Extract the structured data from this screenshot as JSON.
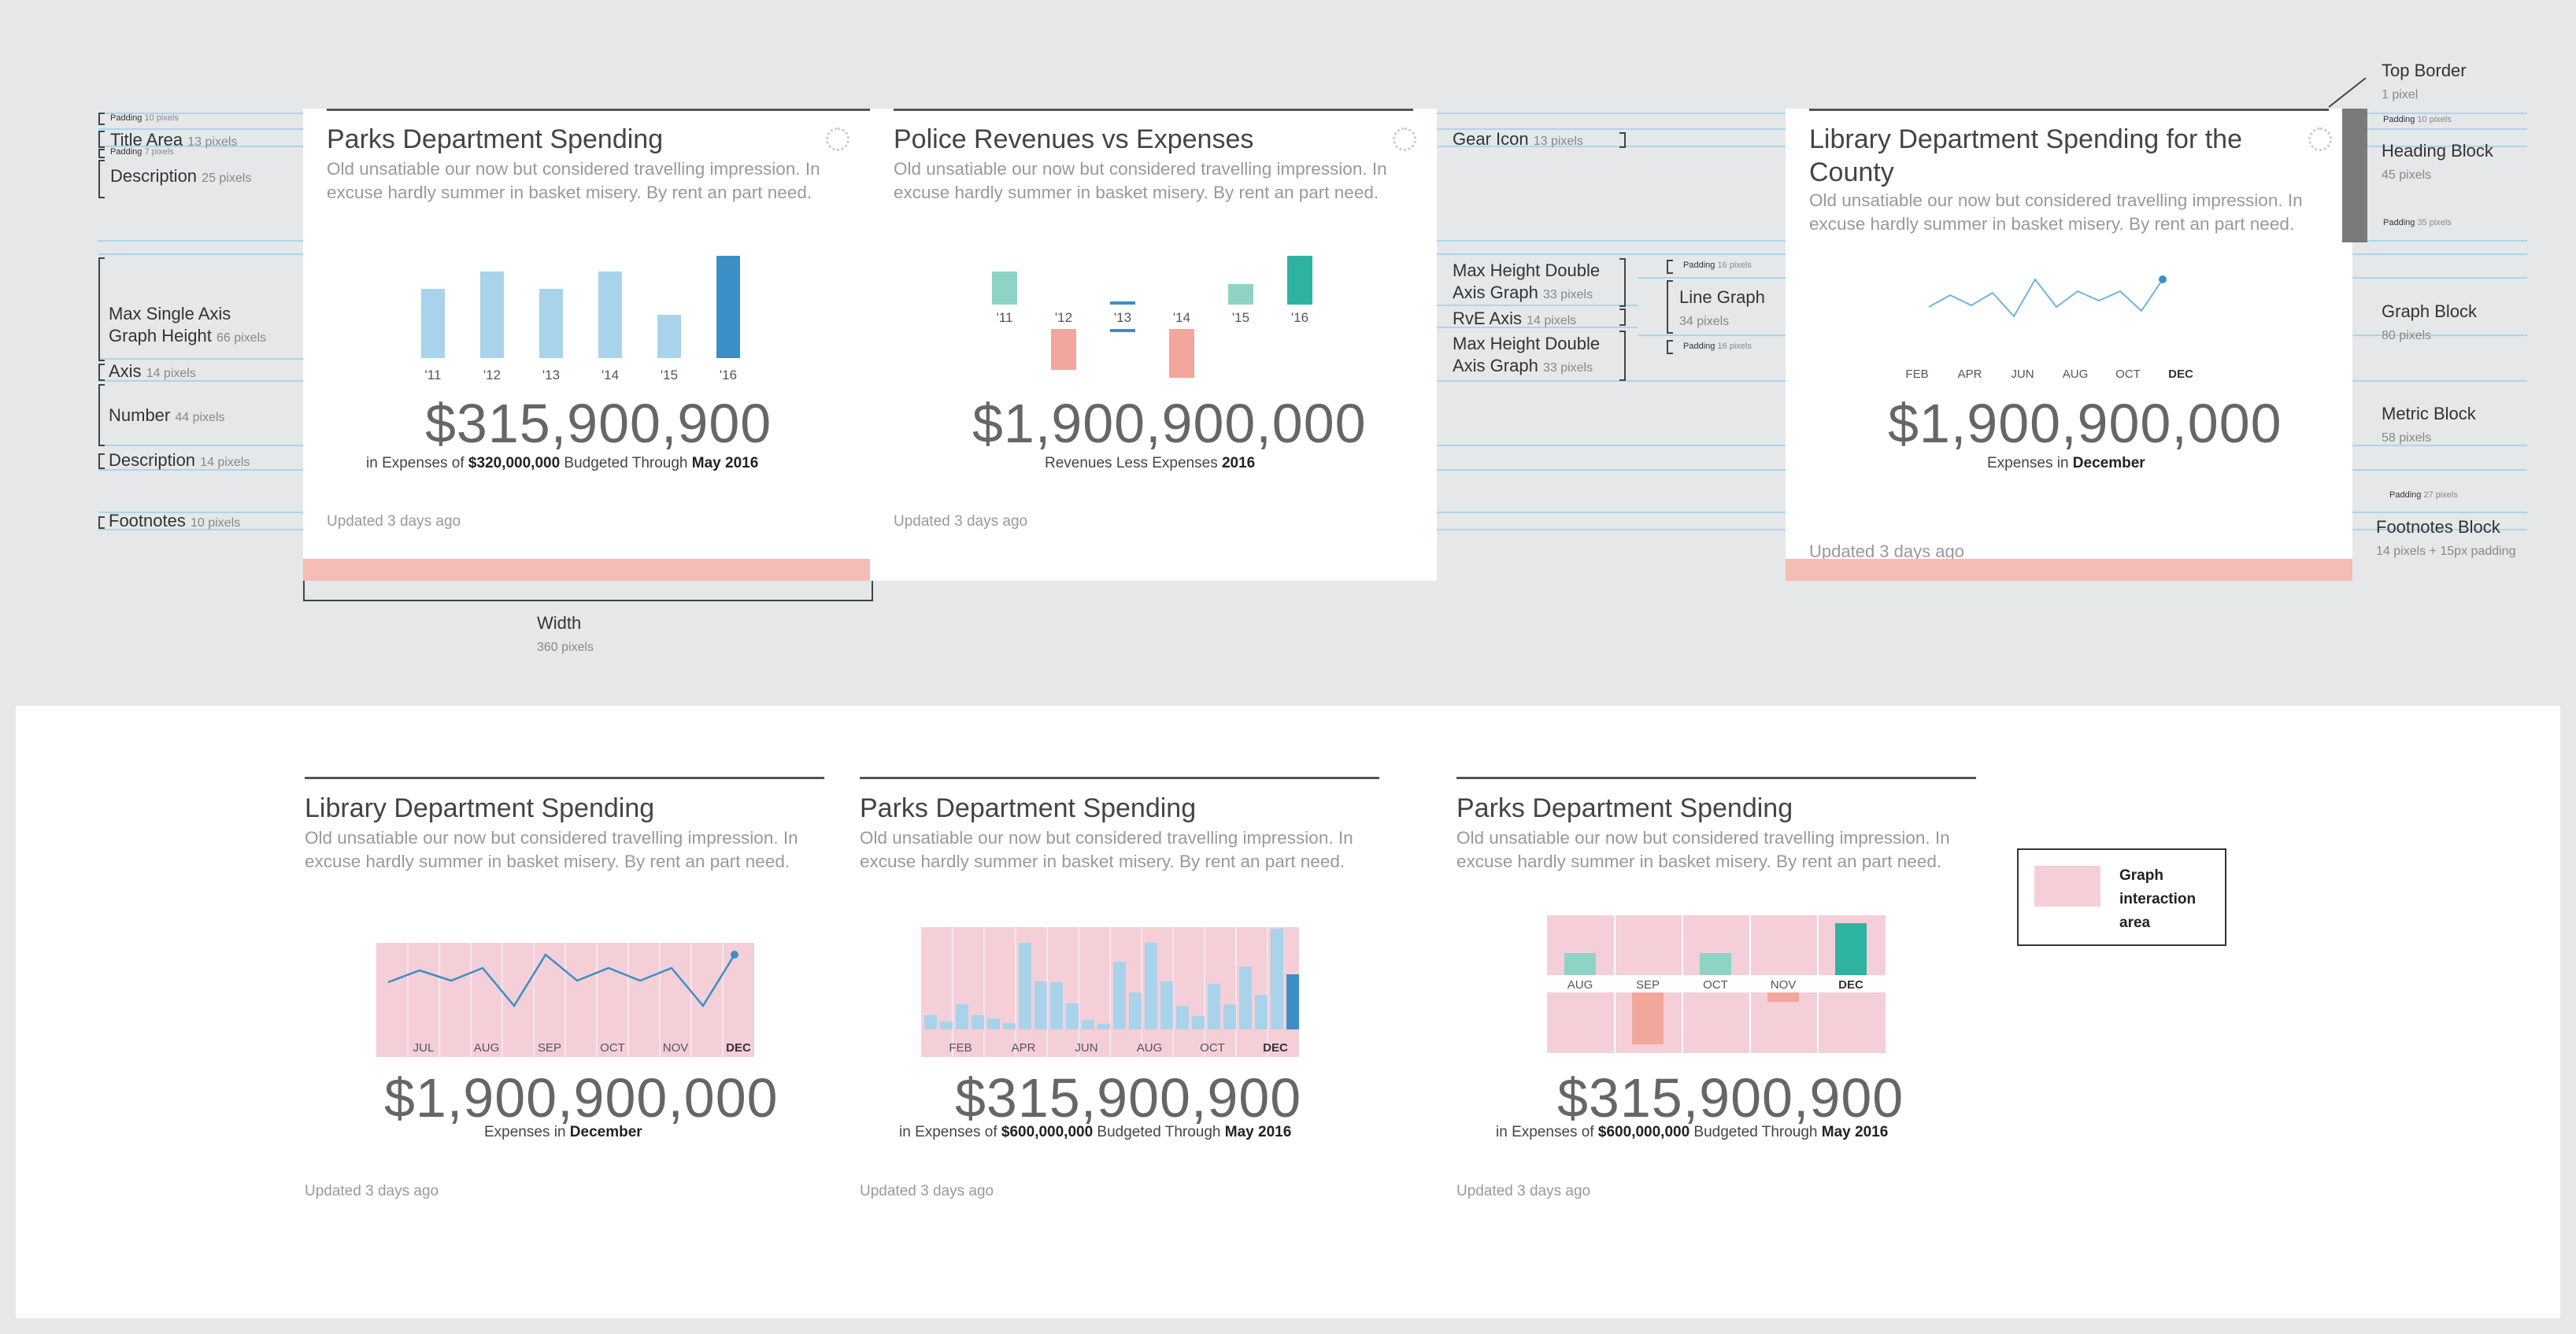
{
  "annotations": {
    "padding_top": {
      "label": "Padding",
      "value": "10 pixels"
    },
    "title_area": {
      "label": "Title Area",
      "value": "13 pixels"
    },
    "padding_mid": {
      "label": "Padding",
      "value": "7 pixels"
    },
    "description": {
      "label": "Description",
      "value": "25 pixels"
    },
    "max_single_axis": {
      "label": "Max Single Axis\nGraph Height",
      "value": "66 pixels"
    },
    "axis": {
      "label": "Axis",
      "value": "14 pixels"
    },
    "number": {
      "label": "Number",
      "value": "44 pixels"
    },
    "description2": {
      "label": "Description",
      "value": "14 pixels"
    },
    "footnotes": {
      "label": "Footnotes",
      "value": "10 pixels"
    },
    "width": {
      "label": "Width",
      "value": "360 pixels"
    },
    "gear_icon": {
      "label": "Gear Icon",
      "value": "13 pixels"
    },
    "max_double_1": {
      "label": "Max Height Double\nAxis Graph",
      "value": "33 pixels"
    },
    "rve_axis": {
      "label": "RvE Axis",
      "value": "14 pixels"
    },
    "max_double_2": {
      "label": "Max Height Double\nAxis Graph",
      "value": "33 pixels"
    },
    "pad16a": {
      "label": "Padding",
      "value": "16 pixels"
    },
    "line_graph": {
      "label": "Line Graph",
      "value": "34 pixels"
    },
    "pad16b": {
      "label": "Padding",
      "value": "16 pixels"
    },
    "top_border": {
      "label": "Top Border",
      "value": "1 pixel"
    },
    "pad10r": {
      "label": "Padding",
      "value": "10 pixels"
    },
    "heading_block": {
      "label": "Heading Block",
      "value": "45 pixels"
    },
    "pad35": {
      "label": "Padding",
      "value": "35 pixels"
    },
    "graph_block": {
      "label": "Graph Block",
      "value": "80 pixels"
    },
    "metric_block": {
      "label": "Metric Block",
      "value": "58 pixels"
    },
    "pad27": {
      "label": "Padding",
      "value": "27 pixels"
    },
    "footnotes_block": {
      "label": "Footnotes Block",
      "value": "14 pixels + 15px padding"
    }
  },
  "card1": {
    "title": "Parks Department Spending",
    "description": "Old unsatiable our now but considered travelling impression. In excuse hardly summer in basket misery. By rent an part need.",
    "metric": "$315,900,900",
    "sub_pre": "in Expenses of ",
    "sub_b1": "$320,000,000",
    "sub_mid": " Budgeted Through ",
    "sub_b2": "May 2016",
    "footnote": "Updated 3 days ago",
    "ticks": [
      "'11",
      "'12",
      "'13",
      "'14",
      "'15",
      "'16"
    ]
  },
  "card2": {
    "title": "Police Revenues vs Expenses",
    "description": "Old unsatiable our now but considered travelling impression. In excuse hardly summer in basket misery. By rent an part need.",
    "metric": "$1,900,900,000",
    "sub_pre": "Revenues Less Expenses ",
    "sub_b1": "2016",
    "footnote": "Updated 3 days ago",
    "ticks": [
      "'11",
      "'12",
      "'13",
      "'14",
      "'15",
      "'16"
    ]
  },
  "card3": {
    "title": "Library Department Spending for the County",
    "description": "Old unsatiable our now but considered travelling impression. In excuse hardly summer in basket misery. By rent an part need.",
    "metric": "$1,900,900,000",
    "sub_pre": "Expenses in ",
    "sub_b1": "December",
    "footnote": "Updated 3 days ago",
    "ticks": [
      "FEB",
      "APR",
      "JUN",
      "AUG",
      "OCT",
      "DEC"
    ]
  },
  "card4": {
    "title": "Library Department Spending",
    "description": "Old unsatiable our now but considered travelling impression. In excuse hardly summer in basket misery. By rent an part need.",
    "metric": "$1,900,900,000",
    "sub_pre": "Expenses in ",
    "sub_b1": "December",
    "footnote": "Updated 3 days ago",
    "ticks": [
      "JUL",
      "AUG",
      "SEP",
      "OCT",
      "NOV",
      "DEC"
    ]
  },
  "card5": {
    "title": "Parks Department Spending",
    "description": "Old unsatiable our now but considered travelling impression. In excuse hardly summer in basket misery. By rent an part need.",
    "metric": "$315,900,900",
    "sub_pre": "in Expenses of ",
    "sub_b1": "$600,000,000",
    "sub_mid": " Budgeted Through ",
    "sub_b2": "May 2016",
    "footnote": "Updated 3 days ago",
    "ticks": [
      "FEB",
      "APR",
      "JUN",
      "AUG",
      "OCT",
      "DEC"
    ]
  },
  "card6": {
    "title": "Parks Department Spending",
    "description": "Old unsatiable our now but considered travelling impression. In excuse hardly summer in basket misery. By rent an part need.",
    "metric": "$315,900,900",
    "sub_pre": "in Expenses of ",
    "sub_b1": "$600,000,000",
    "sub_mid": " Budgeted Through ",
    "sub_b2": "May 2016",
    "footnote": "Updated 3 days ago",
    "ticks": [
      "AUG",
      "SEP",
      "OCT",
      "NOV",
      "DEC"
    ]
  },
  "legend": {
    "label": "Graph interaction area"
  },
  "colors": {
    "light_blue": "#a9d3eb",
    "dark_blue": "#3b8fc6",
    "teal_light": "#8fd3c6",
    "teal": "#2db3a0",
    "salmon": "#f2a79c",
    "pink_area": "#f4cfd8",
    "guide": "#a8d7ec"
  }
}
